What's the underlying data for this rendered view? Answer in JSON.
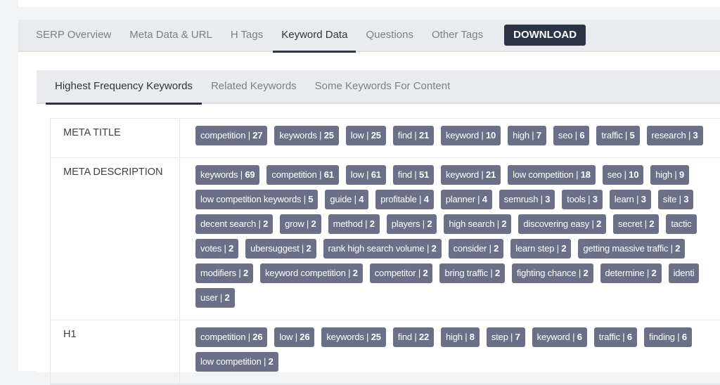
{
  "tabs": [
    {
      "label": "SERP Overview"
    },
    {
      "label": "Meta Data & URL"
    },
    {
      "label": "H Tags"
    },
    {
      "label": "Keyword Data",
      "active": true
    },
    {
      "label": "Questions"
    },
    {
      "label": "Other Tags"
    }
  ],
  "download_label": "DOWNLOAD",
  "subtabs": [
    {
      "label": "Highest Frequency Keywords",
      "active": true
    },
    {
      "label": "Related Keywords"
    },
    {
      "label": "Some Keywords For Content"
    }
  ],
  "rows": [
    {
      "label": "META TITLE",
      "lines": [
        [
          [
            "competition",
            "27"
          ],
          [
            "keywords",
            "25"
          ],
          [
            "low",
            "25"
          ],
          [
            "find",
            "21"
          ],
          [
            "keyword",
            "10"
          ],
          [
            "high",
            "7"
          ],
          [
            "seo",
            "6"
          ],
          [
            "traffic",
            "5"
          ],
          [
            "research",
            "3"
          ]
        ]
      ]
    },
    {
      "label": "META DESCRIPTION",
      "lines": [
        [
          [
            "keywords",
            "69"
          ],
          [
            "competition",
            "61"
          ],
          [
            "low",
            "61"
          ],
          [
            "find",
            "51"
          ],
          [
            "keyword",
            "21"
          ],
          [
            "low competition",
            "18"
          ],
          [
            "seo",
            "10"
          ],
          [
            "high",
            "9"
          ]
        ],
        [
          [
            "low competition keywords",
            "5"
          ],
          [
            "guide",
            "4"
          ],
          [
            "profitable",
            "4"
          ],
          [
            "planner",
            "4"
          ],
          [
            "semrush",
            "3"
          ],
          [
            "tools",
            "3"
          ],
          [
            "learn",
            "3"
          ],
          [
            "site",
            "3"
          ]
        ],
        [
          [
            "decent search",
            "2"
          ],
          [
            "grow",
            "2"
          ],
          [
            "method",
            "2"
          ],
          [
            "players",
            "2"
          ],
          [
            "high search",
            "2"
          ],
          [
            "discovering easy",
            "2"
          ],
          [
            "secret",
            "2"
          ],
          [
            "tactic",
            ""
          ]
        ],
        [
          [
            "votes",
            "2"
          ],
          [
            "ubersuggest",
            "2"
          ],
          [
            "rank high search volume",
            "2"
          ],
          [
            "consider",
            "2"
          ],
          [
            "learn step",
            "2"
          ],
          [
            "getting massive traffic",
            "2"
          ]
        ],
        [
          [
            "modifiers",
            "2"
          ],
          [
            "keyword competition",
            "2"
          ],
          [
            "competitor",
            "2"
          ],
          [
            "bring traffic",
            "2"
          ],
          [
            "fighting chance",
            "2"
          ],
          [
            "determine",
            "2"
          ],
          [
            "identi",
            ""
          ]
        ],
        [
          [
            "user",
            "2"
          ]
        ]
      ]
    },
    {
      "label": "H1",
      "lines": [
        [
          [
            "competition",
            "26"
          ],
          [
            "low",
            "26"
          ],
          [
            "keywords",
            "25"
          ],
          [
            "find",
            "22"
          ],
          [
            "high",
            "8"
          ],
          [
            "step",
            "7"
          ],
          [
            "keyword",
            "6"
          ],
          [
            "traffic",
            "6"
          ],
          [
            "finding",
            "6"
          ]
        ],
        [
          [
            "low competition",
            "2"
          ]
        ]
      ]
    }
  ]
}
